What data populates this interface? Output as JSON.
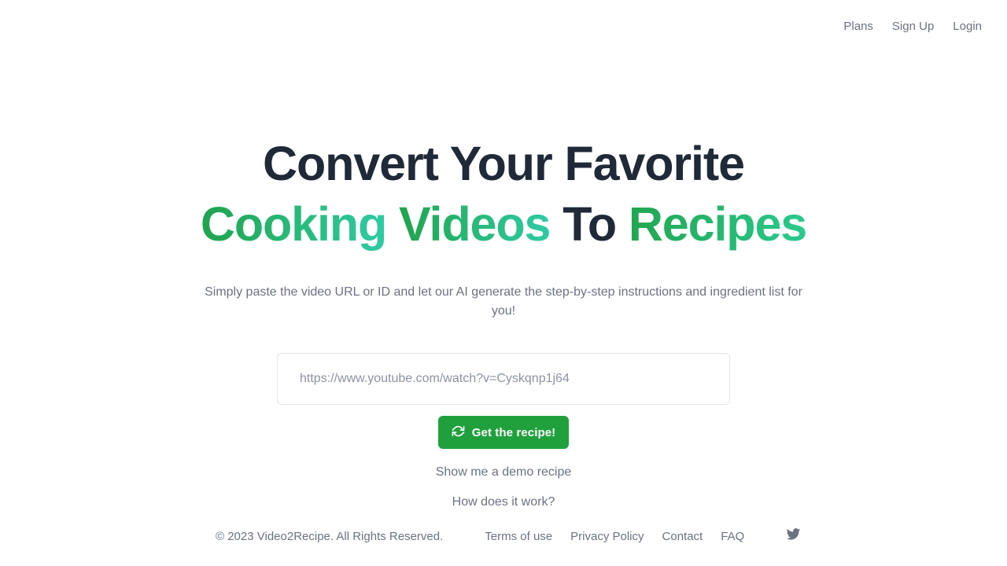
{
  "header": {
    "nav": [
      {
        "label": "Plans",
        "name": "nav-link-plans"
      },
      {
        "label": "Sign Up",
        "name": "nav-link-signup"
      },
      {
        "label": "Login",
        "name": "nav-link-login"
      }
    ]
  },
  "hero": {
    "headline_line1": "Convert Your Favorite",
    "headline_word_cooking": "Cooking",
    "headline_word_videos": "Videos",
    "headline_word_to": "To",
    "headline_word_recipes": "Recipes",
    "subtitle": "Simply paste the video URL or ID and let our AI generate the step-by-step instructions and ingredient list for you!"
  },
  "form": {
    "url_placeholder": "https://www.youtube.com/watch?v=Cyskqnp1j64",
    "url_value": "",
    "cta_label": "Get the recipe!",
    "cta_icon": "refresh-icon",
    "demo_link": "Show me a demo recipe",
    "how_link": "How does it work?"
  },
  "footer": {
    "copyright": "© 2023 Video2Recipe. All Rights Reserved.",
    "links": [
      {
        "label": "Terms of use",
        "name": "footer-link-terms"
      },
      {
        "label": "Privacy Policy",
        "name": "footer-link-privacy"
      },
      {
        "label": "Contact",
        "name": "footer-link-contact"
      },
      {
        "label": "FAQ",
        "name": "footer-link-faq"
      }
    ],
    "social_icon": "twitter-icon"
  },
  "colors": {
    "background": "#ffffff",
    "heading_dark": "#1f2937",
    "gradient_green": "#1fa34e",
    "gradient_teal": "#2ecba4",
    "cta_green": "#20a03c",
    "muted_text": "#6b7280",
    "input_border": "#e3e6ea"
  }
}
